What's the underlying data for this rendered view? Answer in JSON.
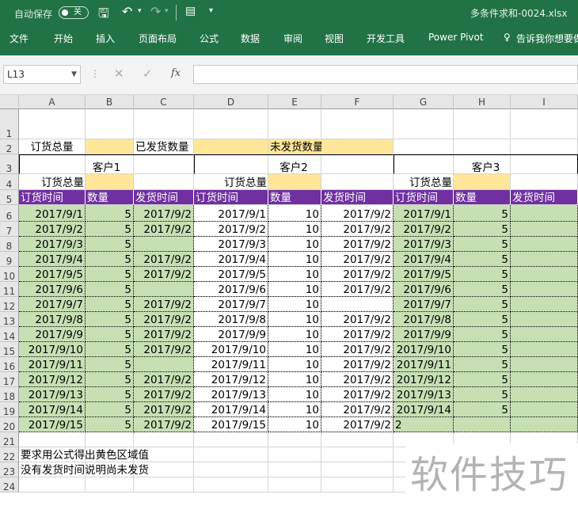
{
  "titlebar": {
    "autosave_label": "自动保存",
    "autosave_state": "关",
    "filename": "多条件求和-0024.xlsx"
  },
  "ribbon_tabs": [
    "文件",
    "开始",
    "插入",
    "页面布局",
    "公式",
    "数据",
    "审阅",
    "视图",
    "开发工具",
    "Power Pivot"
  ],
  "tell_me": "告诉我你想要做",
  "formula_bar": {
    "name_box": "L13",
    "fx_label": "fx",
    "formula": ""
  },
  "columns": [
    "A",
    "B",
    "C",
    "D",
    "E",
    "F",
    "G",
    "H",
    "I"
  ],
  "rows": [
    "1",
    "2",
    "3",
    "4",
    "5",
    "6",
    "7",
    "8",
    "9",
    "10",
    "11",
    "12",
    "13",
    "14",
    "15",
    "16",
    "17",
    "18",
    "19",
    "20",
    "21",
    "22",
    "23",
    "24"
  ],
  "sheet": {
    "r2": {
      "A": "订货总量",
      "C": "已发货数量",
      "E": "未发货数量"
    },
    "r3": {
      "customer1": "客户1",
      "customer2": "客户2",
      "customer3": "客户3"
    },
    "r4": {
      "order_total_1": "订货总量",
      "order_total_2": "订货总量",
      "order_total_3": "订货总量"
    },
    "headers": [
      "订货时间",
      "数量",
      "发货时间",
      "订货时间",
      "数量",
      "发货时间",
      "订货时间",
      "数量",
      "发货时间"
    ],
    "data_rows": [
      [
        "2017/9/1",
        "5",
        "2017/9/2",
        "2017/9/1",
        "10",
        "2017/9/2",
        "2017/9/1",
        "5",
        ""
      ],
      [
        "2017/9/2",
        "5",
        "2017/9/2",
        "2017/9/2",
        "10",
        "2017/9/2",
        "2017/9/2",
        "5",
        ""
      ],
      [
        "2017/9/3",
        "5",
        "",
        "2017/9/3",
        "10",
        "2017/9/2",
        "2017/9/3",
        "5",
        ""
      ],
      [
        "2017/9/4",
        "5",
        "2017/9/2",
        "2017/9/4",
        "10",
        "2017/9/2",
        "2017/9/4",
        "5",
        ""
      ],
      [
        "2017/9/5",
        "5",
        "2017/9/2",
        "2017/9/5",
        "10",
        "2017/9/2",
        "2017/9/5",
        "5",
        ""
      ],
      [
        "2017/9/6",
        "5",
        "",
        "2017/9/6",
        "10",
        "2017/9/2",
        "2017/9/6",
        "5",
        ""
      ],
      [
        "2017/9/7",
        "5",
        "2017/9/2",
        "2017/9/7",
        "10",
        "",
        "2017/9/7",
        "5",
        ""
      ],
      [
        "2017/9/8",
        "5",
        "2017/9/2",
        "2017/9/8",
        "10",
        "2017/9/2",
        "2017/9/8",
        "5",
        ""
      ],
      [
        "2017/9/9",
        "5",
        "2017/9/2",
        "2017/9/9",
        "10",
        "2017/9/2",
        "2017/9/9",
        "5",
        ""
      ],
      [
        "2017/9/10",
        "5",
        "2017/9/2",
        "2017/9/10",
        "10",
        "2017/9/2",
        "2017/9/10",
        "5",
        ""
      ],
      [
        "2017/9/11",
        "5",
        "",
        "2017/9/11",
        "10",
        "2017/9/2",
        "2017/9/11",
        "5",
        ""
      ],
      [
        "2017/9/12",
        "5",
        "2017/9/2",
        "2017/9/12",
        "10",
        "2017/9/2",
        "2017/9/12",
        "5",
        ""
      ],
      [
        "2017/9/13",
        "5",
        "2017/9/2",
        "2017/9/13",
        "10",
        "2017/9/2",
        "2017/9/13",
        "5",
        ""
      ],
      [
        "2017/9/14",
        "5",
        "2017/9/2",
        "2017/9/14",
        "10",
        "2017/9/2",
        "2017/9/14",
        "5",
        ""
      ],
      [
        "2017/9/15",
        "5",
        "2017/9/2",
        "2017/9/15",
        "10",
        "2017/9/2",
        "2",
        "",
        ""
      ]
    ],
    "note1": "要求用公式得出黄色区域值",
    "note2": "没有发货时间说明尚未发货"
  },
  "watermark": "软件技巧",
  "colors": {
    "excel_green": "#217346",
    "header_purple": "#7030a0",
    "green_fill": "#c6e0b4",
    "yellow_fill": "#ffe699"
  }
}
